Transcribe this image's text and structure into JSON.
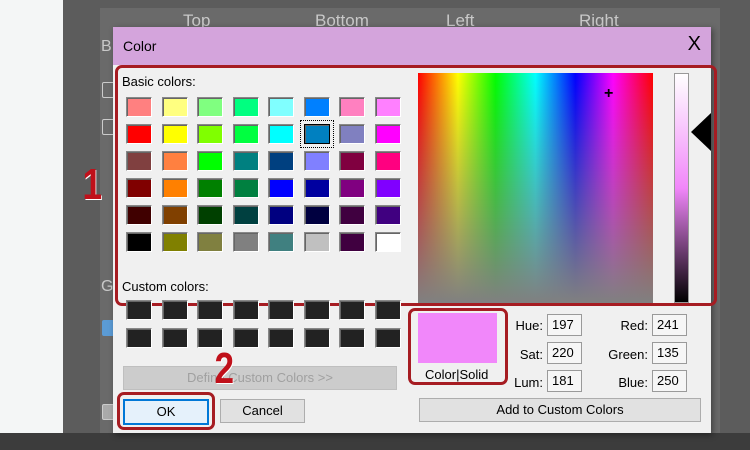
{
  "background": {
    "headers": [
      "Top",
      "Bottom",
      "Left",
      "Right"
    ],
    "side_letters": [
      "B",
      "G"
    ]
  },
  "dialog": {
    "title": "Color",
    "close": "X",
    "basic_label": "Basic colors:",
    "custom_label": "Custom colors:",
    "basic_colors": [
      [
        "#ff8080",
        "#ffff80",
        "#80ff80",
        "#00ff80",
        "#80ffff",
        "#0080ff",
        "#ff80c0",
        "#ff80ff"
      ],
      [
        "#ff0000",
        "#ffff00",
        "#80ff00",
        "#00ff40",
        "#00ffff",
        "#0080c0",
        "#8080c0",
        "#ff00ff"
      ],
      [
        "#804040",
        "#ff8040",
        "#00ff00",
        "#008080",
        "#004080",
        "#8080ff",
        "#800040",
        "#ff0080"
      ],
      [
        "#800000",
        "#ff8000",
        "#008000",
        "#008040",
        "#0000ff",
        "#0000a0",
        "#800080",
        "#8000ff"
      ],
      [
        "#400000",
        "#804000",
        "#004000",
        "#004040",
        "#000080",
        "#000040",
        "#400040",
        "#400080"
      ],
      [
        "#000000",
        "#808000",
        "#808040",
        "#808080",
        "#408080",
        "#c0c0c0",
        "#400040",
        "#ffffff"
      ]
    ],
    "selected_basic": {
      "row": 1,
      "col": 5
    },
    "custom_color_count": 16,
    "define_custom": "Define Custom Colors >>",
    "ok": "OK",
    "cancel": "Cancel",
    "preview_label": "Color|Solid",
    "preview_color": "#f187fa",
    "hue_label": "Hue:",
    "hue": "197",
    "sat_label": "Sat:",
    "sat": "220",
    "lum_label": "Lum:",
    "lum": "181",
    "red_label": "Red:",
    "red": "241",
    "green_label": "Green:",
    "green": "135",
    "blue_label": "Blue:",
    "blue": "250",
    "add_custom": "Add to Custom Colors"
  },
  "annotations": {
    "step1": "1",
    "step2": "2",
    "highlight_color": "#a61c22"
  }
}
